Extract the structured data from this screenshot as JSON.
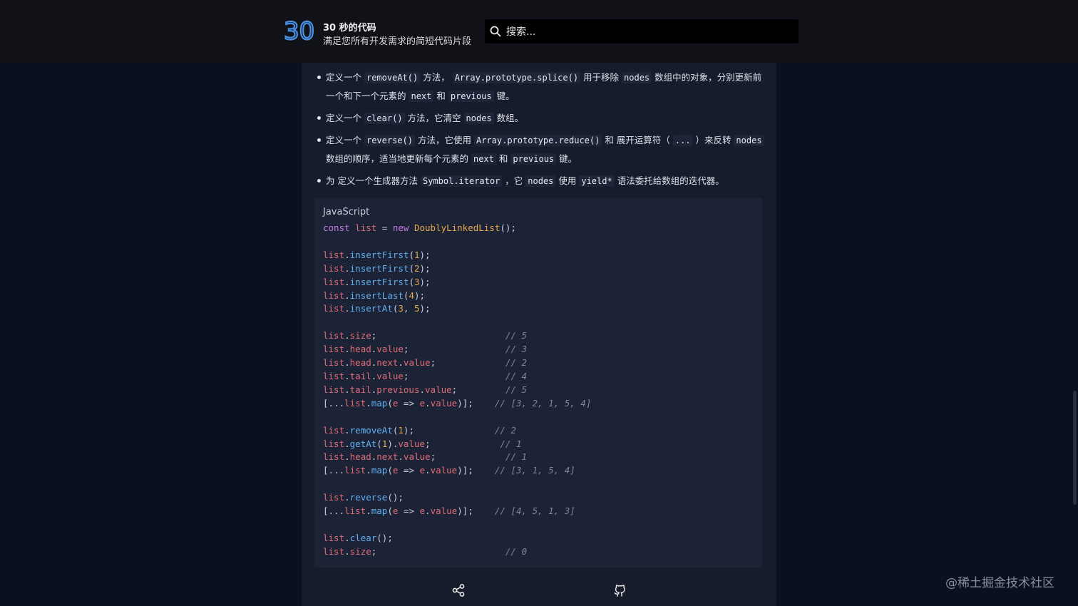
{
  "header": {
    "logo_text": "30",
    "title": "30 秒的代码",
    "subtitle": "满足您所有开发需求的简短代码片段",
    "search_placeholder": "搜索..."
  },
  "bullets": [
    [
      {
        "t": "定义一个 "
      },
      {
        "c": "removeAt()"
      },
      {
        "t": " 方法， "
      },
      {
        "c": "Array.prototype.splice()"
      },
      {
        "t": " 用于移除 "
      },
      {
        "c": "nodes"
      },
      {
        "t": " 数组中的对象，分别更新前一个和下一个元素的 "
      },
      {
        "c": "next"
      },
      {
        "t": " 和 "
      },
      {
        "c": "previous"
      },
      {
        "t": " 键。"
      }
    ],
    [
      {
        "t": "定义一个 "
      },
      {
        "c": "clear()"
      },
      {
        "t": " 方法，它清空 "
      },
      {
        "c": "nodes"
      },
      {
        "t": " 数组。"
      }
    ],
    [
      {
        "t": "定义一个 "
      },
      {
        "c": "reverse()"
      },
      {
        "t": " 方法，它使用 "
      },
      {
        "c": "Array.prototype.reduce()"
      },
      {
        "t": " 和 展开运算符（ "
      },
      {
        "c": "..."
      },
      {
        "t": " ）来反转 "
      },
      {
        "c": "nodes"
      },
      {
        "t": " 数组的顺序，适当地更新每个元素的 "
      },
      {
        "c": "next"
      },
      {
        "t": " 和 "
      },
      {
        "c": "previous"
      },
      {
        "t": " 键。"
      }
    ],
    [
      {
        "t": "为 定义一个生成器方法 "
      },
      {
        "c": "Symbol.iterator"
      },
      {
        "t": " ，它 "
      },
      {
        "c": "nodes"
      },
      {
        "t": " 使用 "
      },
      {
        "c": "yield*"
      },
      {
        "t": " 语法委托给数组的迭代器。"
      }
    ]
  ],
  "code": {
    "language": "JavaScript",
    "lines": [
      [
        [
          "kw",
          "const "
        ],
        [
          "var",
          "list"
        ],
        [
          "pn",
          " = "
        ],
        [
          "kw",
          "new "
        ],
        [
          "cls",
          "DoublyLinkedList"
        ],
        [
          "pn",
          "();"
        ]
      ],
      [],
      [
        [
          "var",
          "list"
        ],
        [
          "pn",
          "."
        ],
        [
          "fn",
          "insertFirst"
        ],
        [
          "pn",
          "("
        ],
        [
          "num",
          "1"
        ],
        [
          "pn",
          ");"
        ]
      ],
      [
        [
          "var",
          "list"
        ],
        [
          "pn",
          "."
        ],
        [
          "fn",
          "insertFirst"
        ],
        [
          "pn",
          "("
        ],
        [
          "num",
          "2"
        ],
        [
          "pn",
          ");"
        ]
      ],
      [
        [
          "var",
          "list"
        ],
        [
          "pn",
          "."
        ],
        [
          "fn",
          "insertFirst"
        ],
        [
          "pn",
          "("
        ],
        [
          "num",
          "3"
        ],
        [
          "pn",
          ");"
        ]
      ],
      [
        [
          "var",
          "list"
        ],
        [
          "pn",
          "."
        ],
        [
          "fn",
          "insertLast"
        ],
        [
          "pn",
          "("
        ],
        [
          "num",
          "4"
        ],
        [
          "pn",
          ");"
        ]
      ],
      [
        [
          "var",
          "list"
        ],
        [
          "pn",
          "."
        ],
        [
          "fn",
          "insertAt"
        ],
        [
          "pn",
          "("
        ],
        [
          "num",
          "3"
        ],
        [
          "pn",
          ", "
        ],
        [
          "num",
          "5"
        ],
        [
          "pn",
          ");"
        ]
      ],
      [],
      [
        [
          "var",
          "list"
        ],
        [
          "pn",
          "."
        ],
        [
          "var",
          "size"
        ],
        [
          "pn",
          ";                        "
        ],
        [
          "cmt",
          "// 5"
        ]
      ],
      [
        [
          "var",
          "list"
        ],
        [
          "pn",
          "."
        ],
        [
          "var",
          "head"
        ],
        [
          "pn",
          "."
        ],
        [
          "var",
          "value"
        ],
        [
          "pn",
          ";                  "
        ],
        [
          "cmt",
          "// 3"
        ]
      ],
      [
        [
          "var",
          "list"
        ],
        [
          "pn",
          "."
        ],
        [
          "var",
          "head"
        ],
        [
          "pn",
          "."
        ],
        [
          "var",
          "next"
        ],
        [
          "pn",
          "."
        ],
        [
          "var",
          "value"
        ],
        [
          "pn",
          ";             "
        ],
        [
          "cmt",
          "// 2"
        ]
      ],
      [
        [
          "var",
          "list"
        ],
        [
          "pn",
          "."
        ],
        [
          "var",
          "tail"
        ],
        [
          "pn",
          "."
        ],
        [
          "var",
          "value"
        ],
        [
          "pn",
          ";                  "
        ],
        [
          "cmt",
          "// 4"
        ]
      ],
      [
        [
          "var",
          "list"
        ],
        [
          "pn",
          "."
        ],
        [
          "var",
          "tail"
        ],
        [
          "pn",
          "."
        ],
        [
          "var",
          "previous"
        ],
        [
          "pn",
          "."
        ],
        [
          "var",
          "value"
        ],
        [
          "pn",
          ";         "
        ],
        [
          "cmt",
          "// 5"
        ]
      ],
      [
        [
          "pn",
          "[..."
        ],
        [
          "var",
          "list"
        ],
        [
          "pn",
          "."
        ],
        [
          "fn",
          "map"
        ],
        [
          "pn",
          "("
        ],
        [
          "var",
          "e"
        ],
        [
          "pn",
          " => "
        ],
        [
          "var",
          "e"
        ],
        [
          "pn",
          "."
        ],
        [
          "var",
          "value"
        ],
        [
          "pn",
          ")];    "
        ],
        [
          "cmt",
          "// [3, 2, 1, 5, 4]"
        ]
      ],
      [],
      [
        [
          "var",
          "list"
        ],
        [
          "pn",
          "."
        ],
        [
          "fn",
          "removeAt"
        ],
        [
          "pn",
          "("
        ],
        [
          "num",
          "1"
        ],
        [
          "pn",
          ");               "
        ],
        [
          "cmt",
          "// 2"
        ]
      ],
      [
        [
          "var",
          "list"
        ],
        [
          "pn",
          "."
        ],
        [
          "fn",
          "getAt"
        ],
        [
          "pn",
          "("
        ],
        [
          "num",
          "1"
        ],
        [
          "pn",
          ")."
        ],
        [
          "var",
          "value"
        ],
        [
          "pn",
          ";             "
        ],
        [
          "cmt",
          "// 1"
        ]
      ],
      [
        [
          "var",
          "list"
        ],
        [
          "pn",
          "."
        ],
        [
          "var",
          "head"
        ],
        [
          "pn",
          "."
        ],
        [
          "var",
          "next"
        ],
        [
          "pn",
          "."
        ],
        [
          "var",
          "value"
        ],
        [
          "pn",
          ";             "
        ],
        [
          "cmt",
          "// 1"
        ]
      ],
      [
        [
          "pn",
          "[..."
        ],
        [
          "var",
          "list"
        ],
        [
          "pn",
          "."
        ],
        [
          "fn",
          "map"
        ],
        [
          "pn",
          "("
        ],
        [
          "var",
          "e"
        ],
        [
          "pn",
          " => "
        ],
        [
          "var",
          "e"
        ],
        [
          "pn",
          "."
        ],
        [
          "var",
          "value"
        ],
        [
          "pn",
          ")];    "
        ],
        [
          "cmt",
          "// [3, 1, 5, 4]"
        ]
      ],
      [],
      [
        [
          "var",
          "list"
        ],
        [
          "pn",
          "."
        ],
        [
          "fn",
          "reverse"
        ],
        [
          "pn",
          "();"
        ]
      ],
      [
        [
          "pn",
          "[..."
        ],
        [
          "var",
          "list"
        ],
        [
          "pn",
          "."
        ],
        [
          "fn",
          "map"
        ],
        [
          "pn",
          "("
        ],
        [
          "var",
          "e"
        ],
        [
          "pn",
          " => "
        ],
        [
          "var",
          "e"
        ],
        [
          "pn",
          "."
        ],
        [
          "var",
          "value"
        ],
        [
          "pn",
          ")];    "
        ],
        [
          "cmt",
          "// [4, 5, 1, 3]"
        ]
      ],
      [],
      [
        [
          "var",
          "list"
        ],
        [
          "pn",
          "."
        ],
        [
          "fn",
          "clear"
        ],
        [
          "pn",
          "();"
        ]
      ],
      [
        [
          "var",
          "list"
        ],
        [
          "pn",
          "."
        ],
        [
          "var",
          "size"
        ],
        [
          "pn",
          ";                        "
        ],
        [
          "cmt",
          "// 0"
        ]
      ]
    ]
  },
  "actions": {
    "share_icon": "share-icon",
    "github_icon": "github-icon"
  },
  "watermark": "@稀土掘金技术社区",
  "colors": {
    "background": "#0b1020",
    "topbar": "#111218",
    "card": "#161c2c",
    "codeblock": "#1c2337",
    "logo_accent": "#4a90e2"
  }
}
